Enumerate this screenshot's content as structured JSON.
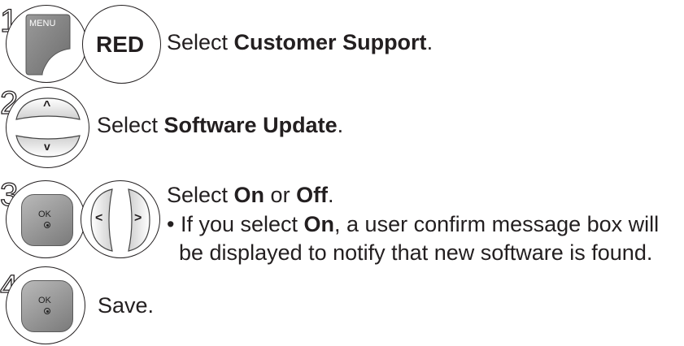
{
  "steps": [
    {
      "number": "1",
      "buttons": [
        {
          "label": "MENU",
          "icon": "menu-button-icon"
        },
        {
          "label": "RED",
          "icon": "red-button-icon"
        }
      ],
      "text_prefix": "Select ",
      "text_bold": "Customer Support",
      "text_suffix": "."
    },
    {
      "number": "2",
      "buttons": [
        {
          "label": "^",
          "icon": "up-arrow-icon"
        },
        {
          "label": "v",
          "icon": "down-arrow-icon"
        }
      ],
      "text_prefix": "Select ",
      "text_bold": "Software Update",
      "text_suffix": "."
    },
    {
      "number": "3",
      "buttons": [
        {
          "label": "OK",
          "icon": "ok-button-icon"
        },
        {
          "label": "<",
          "icon": "left-arrow-icon"
        },
        {
          "label": ">",
          "icon": "right-arrow-icon"
        }
      ],
      "text_prefix": "Select ",
      "text_bold": "On",
      "text_mid": " or ",
      "text_bold2": "Off",
      "text_suffix": ".",
      "note_bullet": "•",
      "note_prefix": " If you select ",
      "note_bold": "On",
      "note_line1_suffix": ", a user confirm message box will",
      "note_line2": "be displayed to notify that new software is found."
    },
    {
      "number": "4",
      "buttons": [
        {
          "label": "OK",
          "icon": "ok-button-icon"
        }
      ],
      "text": "Save."
    }
  ]
}
